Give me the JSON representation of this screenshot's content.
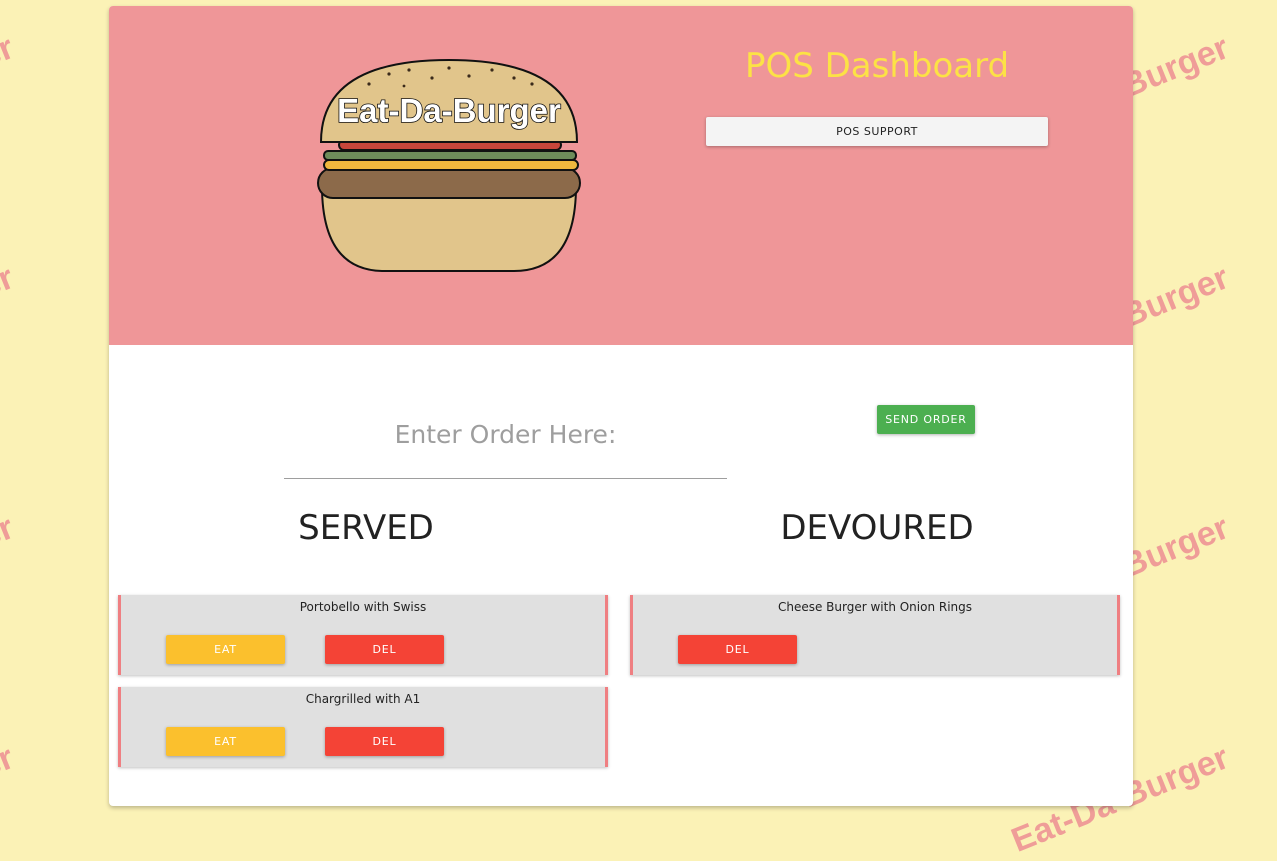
{
  "background": {
    "watermark_text": "Eat-Da-Burger",
    "color": "#fbf2b6",
    "watermark_color": "#ee8f93"
  },
  "header": {
    "logo_text": "Eat-Da-Burger",
    "dashboard_title": "POS Dashboard",
    "support_button": "POS SUPPORT",
    "bg_color": "#ef9698",
    "title_color": "#fce245"
  },
  "order_form": {
    "placeholder": "Enter Order Here:",
    "value": "",
    "send_button": "SEND ORDER",
    "send_color": "#4caf50"
  },
  "columns": {
    "served": {
      "heading": "SERVED",
      "items": [
        {
          "name": "Portobello with Swiss",
          "eat": "EAT",
          "del": "DEL"
        },
        {
          "name": "Chargrilled with A1",
          "eat": "EAT",
          "del": "DEL"
        }
      ]
    },
    "devoured": {
      "heading": "DEVOURED",
      "items": [
        {
          "name": "Cheese Burger with Onion Rings",
          "del": "DEL"
        }
      ]
    }
  },
  "colors": {
    "eat": "#fbc02d",
    "del": "#f44336"
  }
}
